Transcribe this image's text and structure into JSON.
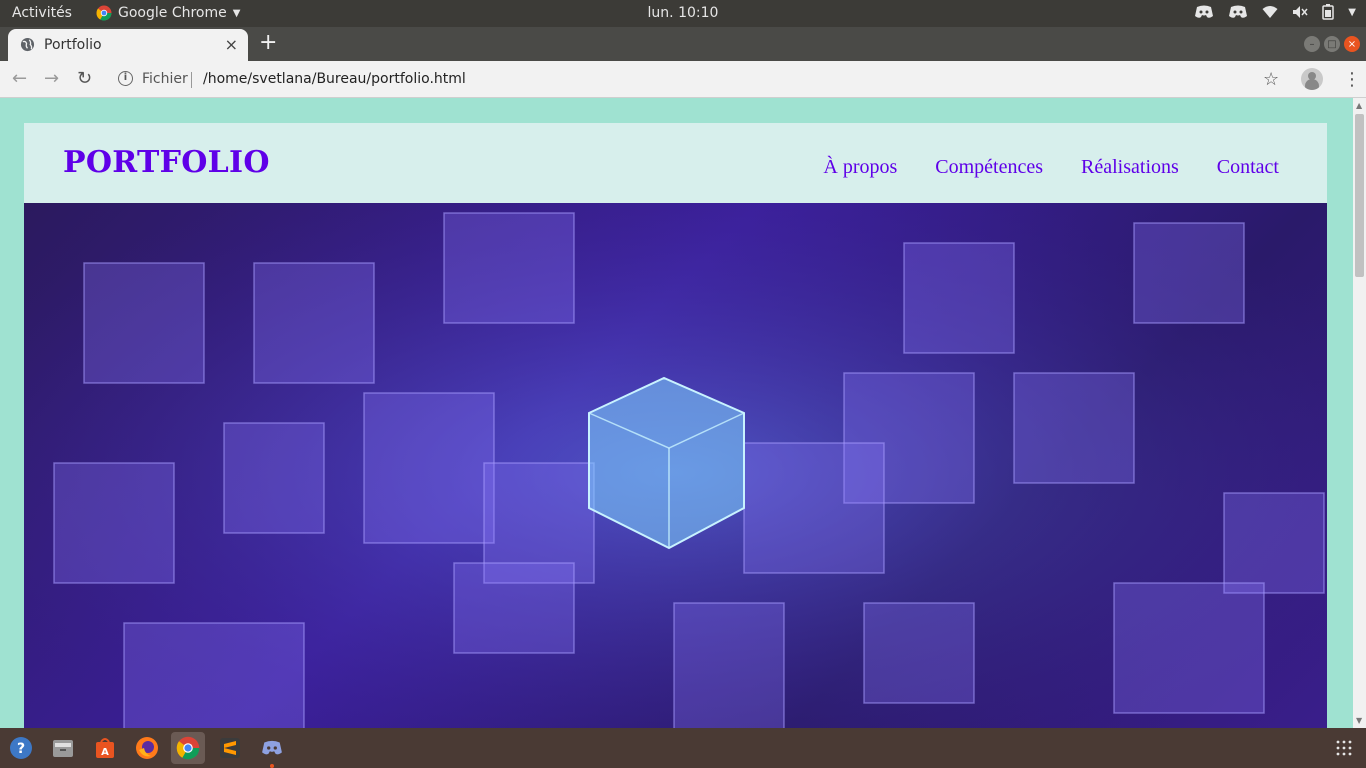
{
  "system_bar": {
    "activities": "Activités",
    "app_name": "Google Chrome",
    "clock": "lun. 10:10",
    "tray_icons": [
      "discord-icon",
      "discord-icon",
      "wifi-icon",
      "volume-muted-icon",
      "battery-icon",
      "chevron-down-icon"
    ]
  },
  "browser": {
    "tab_title": "Portfolio",
    "tab_close": "×",
    "new_tab": "+",
    "scheme_label": "Fichier",
    "url": "/home/svetlana/Bureau/portfolio.html"
  },
  "page": {
    "logo": "PORTFOLIO",
    "nav": [
      "À propos",
      "Compétences",
      "Réalisations",
      "Contact"
    ],
    "colors": {
      "background": "#9fe2d1",
      "header": "#d7efec",
      "accent": "#5f00e8"
    }
  },
  "dock": {
    "items": [
      "help-icon",
      "files-icon",
      "software-center-icon",
      "firefox-icon",
      "chrome-icon",
      "sublime-text-icon",
      "discord-icon",
      "show-apps-icon"
    ]
  }
}
